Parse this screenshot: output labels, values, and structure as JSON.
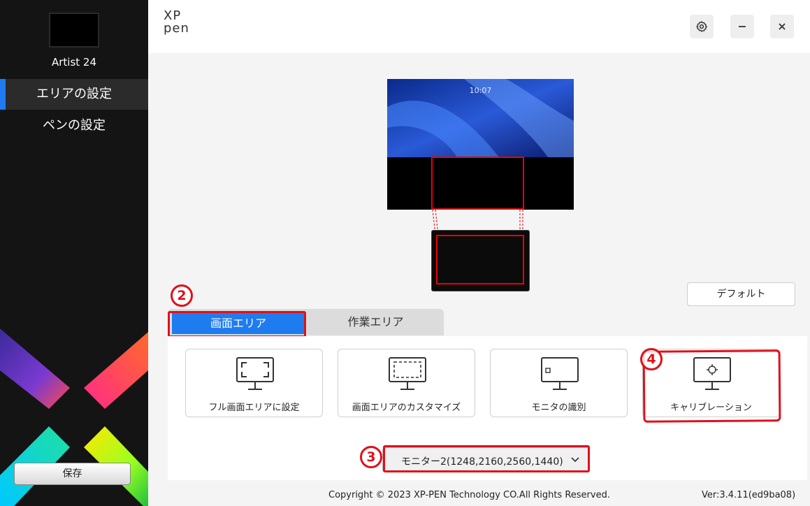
{
  "sidebar": {
    "device_name": "Artist 24",
    "items": [
      {
        "label": "エリアの設定",
        "active": true
      },
      {
        "label": "ペンの設定",
        "active": false
      }
    ],
    "save_label": "保存"
  },
  "header": {
    "logo_line1": "XP",
    "logo_line2": "pen",
    "icons": [
      "gear-icon",
      "minimize-icon",
      "close-icon"
    ]
  },
  "preview": {
    "time": "10:07"
  },
  "default_label": "デフォルト",
  "tabs": [
    {
      "label": "画面エリア",
      "active": true
    },
    {
      "label": "作業エリア",
      "active": false
    }
  ],
  "actions": [
    {
      "label": "フル画面エリアに設定",
      "icon": "fullscreen-monitor-icon"
    },
    {
      "label": "画面エリアのカスタマイズ",
      "icon": "custom-area-monitor-icon"
    },
    {
      "label": "モニタの識別",
      "icon": "identify-monitor-icon"
    },
    {
      "label": "キャリブレーション",
      "icon": "calibration-monitor-icon"
    }
  ],
  "monitor_select": {
    "value": "モニター2(1248,2160,2560,1440)"
  },
  "badges": [
    "2",
    "3",
    "4"
  ],
  "footer": {
    "copyright": "Copyright © 2023  XP-PEN Technology CO.All Rights Reserved.",
    "version": "Ver:3.4.11(ed9ba08)"
  },
  "colors": {
    "accent": "#1e7cf0",
    "annotation": "#e0101a",
    "sidebar_bg": "#141414"
  }
}
